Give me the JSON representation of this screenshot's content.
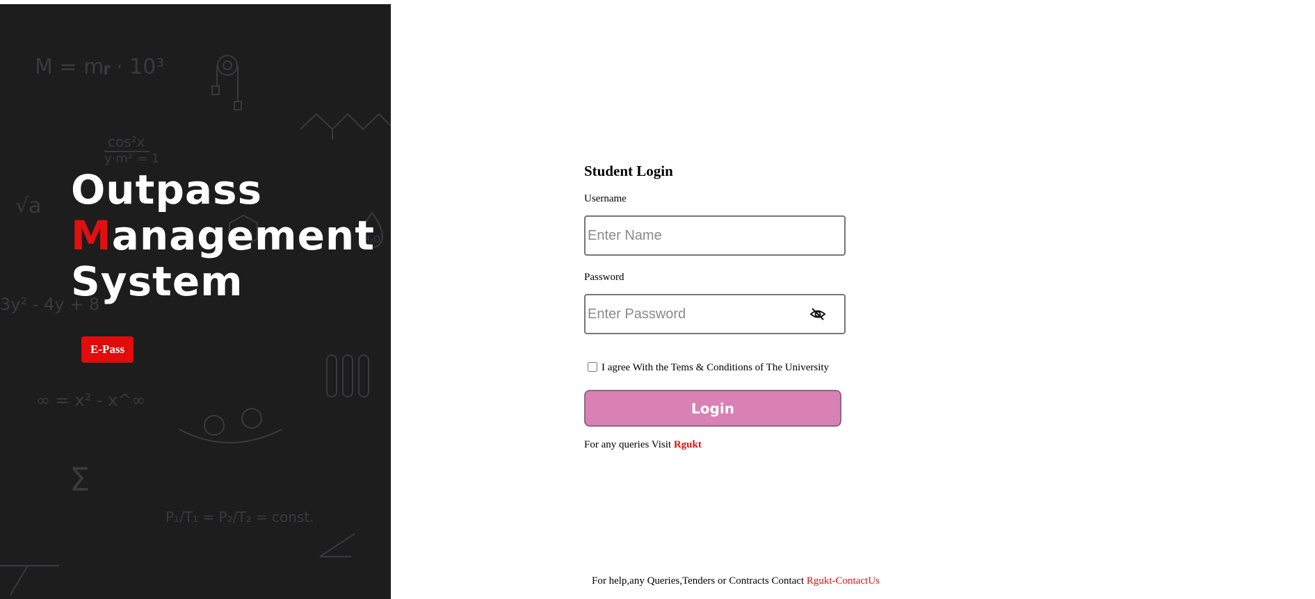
{
  "branding": {
    "title_line1": "Outpass",
    "title_accent_letter": "M",
    "title_line2_rest": "anagement",
    "title_line3": "System",
    "badge": "E-Pass"
  },
  "login": {
    "heading": "Student Login",
    "username_label": "Username",
    "username_placeholder": "Enter Name",
    "password_label": "Password",
    "password_placeholder": "Enter Password",
    "agree_text": "I agree With the Tems & Conditions of The University",
    "login_button": "Login",
    "query_text": "For any queries Visit",
    "query_link": "Rgukt"
  },
  "footer": {
    "text": "For help,any Queries,Tenders or Contracts Contact",
    "link": "Rgukt-ContactUs"
  },
  "icons": {
    "password_toggle": "eye-slash-icon"
  },
  "colors": {
    "panel_bg": "#1e1d1e",
    "accent_red": "#e10c0c",
    "login_button": "#d980b4"
  }
}
